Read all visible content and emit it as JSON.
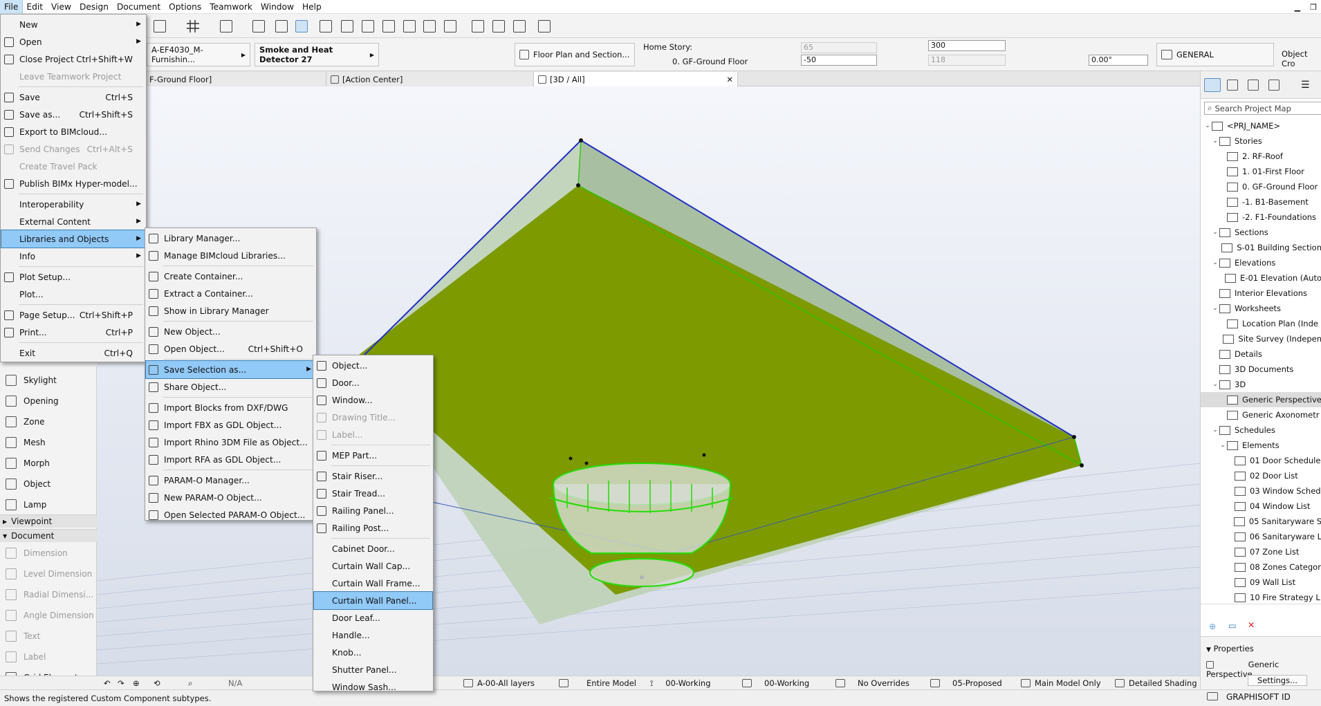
{
  "menubar": [
    "File",
    "Edit",
    "View",
    "Design",
    "Document",
    "Options",
    "Teamwork",
    "Window",
    "Help"
  ],
  "info": {
    "library_part": "A-EF4030_M- Furnishin...",
    "object_name": "Smoke and Heat Detector 27",
    "floor_plan": "Floor Plan and Section...",
    "home_story_label": "Home Story:",
    "home_story": "0. GF-Ground Floor",
    "val_65": "65",
    "val_neg50": "-50",
    "val_300": "300",
    "val_118": "118",
    "angle": "0.00°",
    "layer": "GENERAL",
    "object_cross": "Object Cro"
  },
  "tabs": {
    "tab1": "F-Ground Floor]",
    "tab2": "[Action Center]",
    "tab3": "[3D / All]"
  },
  "toolbox": {
    "items": [
      {
        "label": "Skylight",
        "dis": false
      },
      {
        "label": "Opening",
        "dis": false
      },
      {
        "label": "Zone",
        "dis": false
      },
      {
        "label": "Mesh",
        "dis": false
      },
      {
        "label": "Morph",
        "dis": false
      },
      {
        "label": "Object",
        "dis": false
      },
      {
        "label": "Lamp",
        "dis": false
      }
    ],
    "viewpoint": "Viewpoint",
    "document": "Document",
    "doc_items": [
      {
        "label": "Dimension"
      },
      {
        "label": "Level Dimension"
      },
      {
        "label": "Radial Dimensi..."
      },
      {
        "label": "Angle Dimension"
      },
      {
        "label": "Text"
      },
      {
        "label": "Label"
      },
      {
        "label": "Grid Element"
      }
    ]
  },
  "file_menu": [
    {
      "label": "New",
      "arrow": true,
      "icon": false
    },
    {
      "label": "Open",
      "arrow": true,
      "icon": true
    },
    {
      "label": "Close Project",
      "shortcut": "Ctrl+Shift+W",
      "icon": true
    },
    {
      "label": "Leave Teamwork Project",
      "dis": true,
      "icon": false
    },
    {
      "label": "Save",
      "shortcut": "Ctrl+S",
      "icon": true
    },
    {
      "label": "Save as...",
      "shortcut": "Ctrl+Shift+S",
      "icon": true
    },
    {
      "label": "Export to BIMcloud...",
      "icon": true
    },
    {
      "label": "Send Changes",
      "shortcut": "Ctrl+Alt+S",
      "dis": true,
      "icon": true
    },
    {
      "label": "Create Travel Pack",
      "dis": true,
      "icon": false
    },
    {
      "label": "Publish BIMx Hyper-model...",
      "icon": true
    },
    {
      "label": "Interoperability",
      "arrow": true,
      "icon": false
    },
    {
      "label": "External Content",
      "arrow": true,
      "icon": false
    },
    {
      "label": "Libraries and Objects",
      "arrow": true,
      "icon": false,
      "hl": true
    },
    {
      "label": "Info",
      "arrow": true,
      "icon": false
    },
    {
      "label": "Plot Setup...",
      "icon": true
    },
    {
      "label": "Plot...",
      "icon": false
    },
    {
      "label": "Page Setup...",
      "shortcut": "Ctrl+Shift+P",
      "icon": true
    },
    {
      "label": "Print...",
      "shortcut": "Ctrl+P",
      "icon": true
    },
    {
      "label": "Exit",
      "shortcut": "Ctrl+Q",
      "icon": false
    }
  ],
  "lib_menu": [
    {
      "label": "Library Manager..."
    },
    {
      "label": "Manage BIMcloud Libraries..."
    },
    {
      "label": "Create Container..."
    },
    {
      "label": "Extract a Container..."
    },
    {
      "label": "Show in Library Manager"
    },
    {
      "label": "New Object..."
    },
    {
      "label": "Open Object...",
      "shortcut": "Ctrl+Shift+O"
    },
    {
      "label": "Save Selection as...",
      "arrow": true,
      "hl": true
    },
    {
      "label": "Share Object..."
    },
    {
      "label": "Import Blocks from DXF/DWG"
    },
    {
      "label": "Import FBX as GDL Object..."
    },
    {
      "label": "Import Rhino 3DM File as Object..."
    },
    {
      "label": "Import RFA as GDL Object..."
    },
    {
      "label": "PARAM-O Manager..."
    },
    {
      "label": "New PARAM-O Object..."
    },
    {
      "label": "Open Selected PARAM-O Object..."
    }
  ],
  "save_menu": [
    {
      "label": "Object..."
    },
    {
      "label": "Door..."
    },
    {
      "label": "Window..."
    },
    {
      "label": "Drawing Title...",
      "dis": true
    },
    {
      "label": "Label...",
      "dis": true
    },
    {
      "label": "MEP Part..."
    },
    {
      "label": "Stair Riser..."
    },
    {
      "label": "Stair Tread..."
    },
    {
      "label": "Railing Panel..."
    },
    {
      "label": "Railing Post..."
    },
    {
      "label": "Cabinet Door..."
    },
    {
      "label": "Curtain Wall Cap..."
    },
    {
      "label": "Curtain Wall Frame..."
    },
    {
      "label": "Curtain Wall Panel...",
      "hl": true
    },
    {
      "label": "Door Leaf..."
    },
    {
      "label": "Handle..."
    },
    {
      "label": "Knob..."
    },
    {
      "label": "Shutter Panel..."
    },
    {
      "label": "Window Sash..."
    }
  ],
  "status": {
    "na": "N/A",
    "layers": "A-00-All layers",
    "model": "Entire Model",
    "working1": "00-Working",
    "working2": "00-Working",
    "overrides": "No Overrides",
    "proposed": "05-Proposed",
    "main_model": "Main Model Only",
    "shading": "Detailed Shading"
  },
  "help_text": "Shows the registered Custom Component subtypes.",
  "navigator": {
    "search_placeholder": "Search Project Map",
    "rows": [
      {
        "label": "<PRJ_NAME>",
        "lvl": 0,
        "chev": "v"
      },
      {
        "label": "Stories",
        "lvl": 1,
        "chev": "v"
      },
      {
        "label": "2. RF-Roof",
        "lvl": 2
      },
      {
        "label": "1. 01-First Floor",
        "lvl": 2
      },
      {
        "label": "0. GF-Ground Floor",
        "lvl": 2
      },
      {
        "label": "-1. B1-Basement",
        "lvl": 2
      },
      {
        "label": "-2. F1-Foundations",
        "lvl": 2
      },
      {
        "label": "Sections",
        "lvl": 1,
        "chev": "v"
      },
      {
        "label": "S-01 Building Section",
        "lvl": 2
      },
      {
        "label": "Elevations",
        "lvl": 1,
        "chev": "v"
      },
      {
        "label": "E-01 Elevation (Auto",
        "lvl": 2
      },
      {
        "label": "Interior Elevations",
        "lvl": 1
      },
      {
        "label": "Worksheets",
        "lvl": 1,
        "chev": "v"
      },
      {
        "label": "Location Plan (Inde",
        "lvl": 2
      },
      {
        "label": "Site Survey (Indepen",
        "lvl": 2
      },
      {
        "label": "Details",
        "lvl": 1
      },
      {
        "label": "3D Documents",
        "lvl": 1
      },
      {
        "label": "3D",
        "lvl": 1,
        "chev": "v"
      },
      {
        "label": "Generic Perspective",
        "lvl": 2,
        "sel": true
      },
      {
        "label": "Generic Axonometr",
        "lvl": 2
      },
      {
        "label": "Schedules",
        "lvl": 1,
        "chev": "v"
      },
      {
        "label": "Elements",
        "lvl": 2,
        "chev": "v"
      },
      {
        "label": "01 Door Schedule",
        "lvl": 3
      },
      {
        "label": "02 Door List",
        "lvl": 3
      },
      {
        "label": "03 Window Sched",
        "lvl": 3
      },
      {
        "label": "04 Window List",
        "lvl": 3
      },
      {
        "label": "05 Sanitaryware S",
        "lvl": 3
      },
      {
        "label": "06 Sanitaryware L",
        "lvl": 3
      },
      {
        "label": "07 Zone List",
        "lvl": 3
      },
      {
        "label": "08 Zones Categor",
        "lvl": 3
      },
      {
        "label": "09 Wall List",
        "lvl": 3
      },
      {
        "label": "10 Fire Strategy L",
        "lvl": 3
      }
    ]
  },
  "props": {
    "title": "Properties",
    "value": "Generic Perspective",
    "settings": "Settings..."
  },
  "brand": "GRAPHISOFT ID"
}
